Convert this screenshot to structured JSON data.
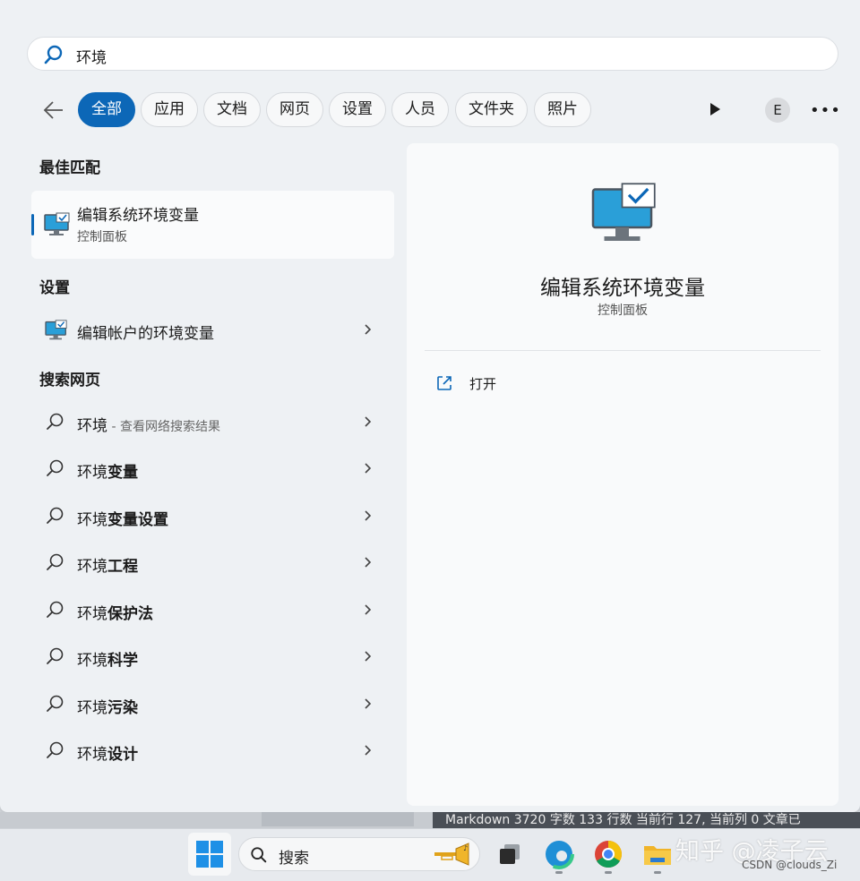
{
  "search": {
    "query": "环境"
  },
  "filters": [
    "全部",
    "应用",
    "文档",
    "网页",
    "设置",
    "人员",
    "文件夹",
    "照片"
  ],
  "account_initial": "E",
  "best_match": {
    "heading": "最佳匹配",
    "title": "编辑系统环境变量",
    "subtitle": "控制面板"
  },
  "settings_section": {
    "heading": "设置",
    "items": [
      {
        "label": "编辑帐户的环境变量"
      }
    ]
  },
  "web_section": {
    "heading": "搜索网页",
    "first": {
      "prefix": "环境",
      "hint": " - 查看网络搜索结果"
    },
    "items": [
      {
        "prefix": "环境",
        "bold": "变量"
      },
      {
        "prefix": "环境",
        "bold": "变量设置"
      },
      {
        "prefix": "环境",
        "bold": "工程"
      },
      {
        "prefix": "环境",
        "bold": "保护法"
      },
      {
        "prefix": "环境",
        "bold": "科学"
      },
      {
        "prefix": "环境",
        "bold": "污染"
      },
      {
        "prefix": "环境",
        "bold": "设计"
      }
    ]
  },
  "preview": {
    "title": "编辑系统环境变量",
    "subtitle": "控制面板",
    "open_label": "打开"
  },
  "background_status": "Markdown  3720 字数  133 行数  当前行 127, 当前列 0  文章已",
  "taskbar": {
    "search_label": "搜索"
  },
  "watermark": {
    "zhihu": "知乎 @凌子云",
    "csdn": "CSDN @clouds_Zi"
  },
  "colors": {
    "accent": "#0c67b7",
    "panel_bg": "#eef1f4"
  }
}
